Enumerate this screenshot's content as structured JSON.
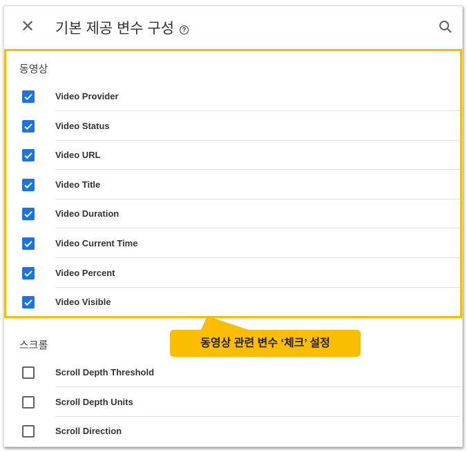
{
  "header": {
    "title": "기본 제공 변수 구성",
    "help_icon": "help-circle-icon",
    "close_icon": "close-icon",
    "search_icon": "search-icon"
  },
  "sections": [
    {
      "label": "동영상",
      "items": [
        {
          "label": "Video Provider",
          "checked": true
        },
        {
          "label": "Video Status",
          "checked": true
        },
        {
          "label": "Video URL",
          "checked": true
        },
        {
          "label": "Video Title",
          "checked": true
        },
        {
          "label": "Video Duration",
          "checked": true
        },
        {
          "label": "Video Current Time",
          "checked": true
        },
        {
          "label": "Video Percent",
          "checked": true
        },
        {
          "label": "Video Visible",
          "checked": true
        }
      ]
    },
    {
      "label": "스크롤",
      "items": [
        {
          "label": "Scroll Depth Threshold",
          "checked": false
        },
        {
          "label": "Scroll Depth Units",
          "checked": false
        },
        {
          "label": "Scroll Direction",
          "checked": false
        }
      ]
    }
  ],
  "callout": {
    "text": "동영상 관련 변수 ‘체크’ 설정"
  },
  "colors": {
    "highlight": "#f7bd00",
    "checkbox": "#1a73e8",
    "callout": "#fbbd00"
  }
}
